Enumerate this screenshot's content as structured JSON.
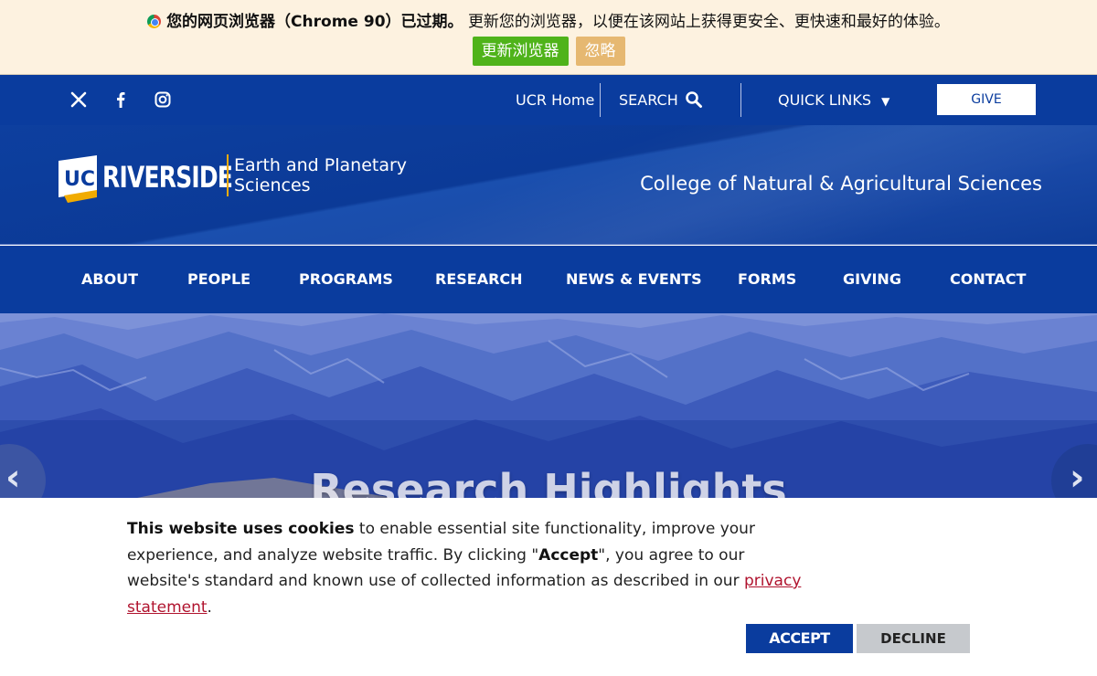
{
  "update_bar": {
    "prefix_bold": "您的网页浏览器（Chrome 90）已过期。",
    "message": "更新您的浏览器，以便在该网站上获得更安全、更快速和最好的体验。",
    "update_label": "更新浏览器",
    "ignore_label": "忽略"
  },
  "utility": {
    "social": [
      "x-icon",
      "facebook-icon",
      "instagram-icon"
    ],
    "ucr_home": "UCR Home",
    "search": "SEARCH",
    "quick_links": "QUICK LINKS",
    "give": "GIVE"
  },
  "header": {
    "logo_uc": "UC",
    "logo_word": "RIVERSIDE",
    "dept_line1": "Earth and Planetary",
    "dept_line2": "Sciences",
    "college": "College of Natural & Agricultural Sciences"
  },
  "nav": {
    "items": [
      "ABOUT",
      "PEOPLE",
      "PROGRAMS",
      "RESEARCH",
      "NEWS & EVENTS",
      "FORMS",
      "GIVING",
      "CONTACT"
    ]
  },
  "hero": {
    "title": "Research Highlights"
  },
  "cookie": {
    "bold_lead": "This website uses cookies",
    "text_1": " to enable essential site functionality, improve your experience, and analyze website traffic. By clicking \"",
    "bold_accept": "Accept",
    "text_2": "\", you agree to our website's standard and known use of collected information as described in our ",
    "link": "privacy statement",
    "text_3": ".",
    "accept_label": "ACCEPT",
    "decline_label": "DECLINE"
  },
  "colors": {
    "ucr_blue": "#0a3c9e",
    "ucr_gold": "#f1ab00",
    "update_green": "#4fb31a",
    "ignore_tan": "#e6b871",
    "link_red": "#b0132e"
  }
}
